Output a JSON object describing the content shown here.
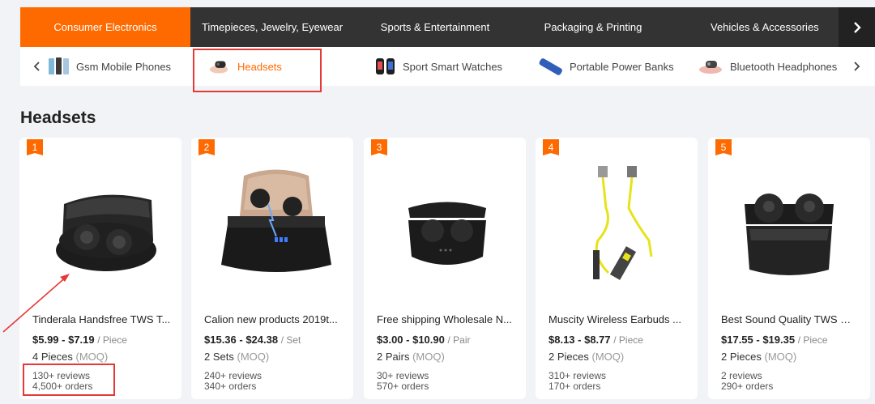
{
  "top_categories": [
    {
      "label": "Consumer Electronics",
      "active": true
    },
    {
      "label": "Timepieces, Jewelry, Eyewear",
      "active": false
    },
    {
      "label": "Sports & Entertainment",
      "active": false
    },
    {
      "label": "Packaging & Printing",
      "active": false
    },
    {
      "label": "Vehicles & Accessories",
      "active": false
    }
  ],
  "sub_categories": [
    {
      "label": "Gsm Mobile Phones",
      "icon": "mobile-phones-icon",
      "active": false
    },
    {
      "label": "Headsets",
      "icon": "headset-icon",
      "active": true
    },
    {
      "label": "Sport Smart Watches",
      "icon": "smart-watch-icon",
      "active": false
    },
    {
      "label": "Portable Power Banks",
      "icon": "power-bank-icon",
      "active": false
    },
    {
      "label": "Bluetooth Headphones",
      "icon": "headphones-icon",
      "active": false
    }
  ],
  "section_title": "Headsets",
  "products": [
    {
      "rank": "1",
      "title": "Tinderala Handsfree TWS T...",
      "price": "$5.99 - $7.19",
      "unit": "/ Piece",
      "moq": "4 Pieces",
      "moq_tag": "(MOQ)",
      "reviews": "130+ reviews",
      "orders": "4,500+ orders",
      "image": "tws-earbuds-case-image"
    },
    {
      "rank": "2",
      "title": "Calion new products 2019t...",
      "price": "$15.36 - $24.38",
      "unit": "/ Set",
      "moq": "2 Sets",
      "moq_tag": "(MOQ)",
      "reviews": "240+ reviews",
      "orders": "340+ orders",
      "image": "earbuds-powerbank-case-image"
    },
    {
      "rank": "3",
      "title": "Free shipping Wholesale N...",
      "price": "$3.00 - $10.90",
      "unit": "/ Pair",
      "moq": "2 Pairs",
      "moq_tag": "(MOQ)",
      "reviews": "30+ reviews",
      "orders": "570+ orders",
      "image": "mini-earbuds-case-image"
    },
    {
      "rank": "4",
      "title": "Muscity Wireless Earbuds ...",
      "price": "$8.13 - $8.77",
      "unit": "/ Piece",
      "moq": "2 Pieces",
      "moq_tag": "(MOQ)",
      "reviews": "310+ reviews",
      "orders": "170+ orders",
      "image": "neckband-earphones-image"
    },
    {
      "rank": "5",
      "title": "Best Sound Quality TWS Wi...",
      "price": "$17.55 - $19.35",
      "unit": "/ Piece",
      "moq": "2 Pieces",
      "moq_tag": "(MOQ)",
      "reviews": "2 reviews",
      "orders": "290+ orders",
      "image": "square-earbuds-case-image"
    }
  ],
  "colors": {
    "accent": "#ff6a00",
    "topbar": "#333333",
    "highlight": "#e53935"
  }
}
